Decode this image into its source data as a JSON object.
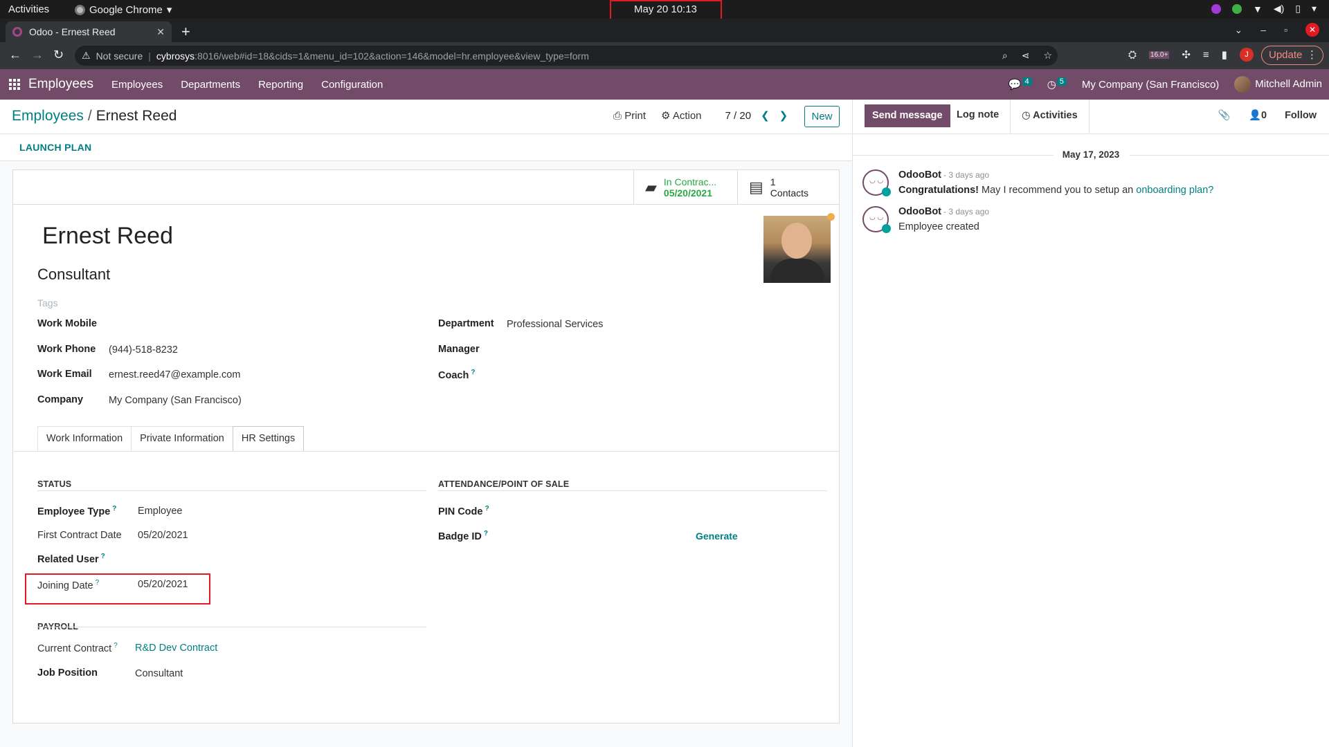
{
  "os_bar": {
    "activities": "Activities",
    "app_name": "Google Chrome",
    "clock": "May 20  10:13"
  },
  "browser": {
    "tab_title": "Odoo - Ernest Reed",
    "not_secure": "Not secure",
    "url_host": "cybrosys",
    "url_path": ":8016/web#id=18&cids=1&menu_id=102&action=146&model=hr.employee&view_type=form",
    "ext_badge": "16.0+",
    "profile_initial": "J",
    "update_label": "Update"
  },
  "navbar": {
    "app_title": "Employees",
    "menus": [
      "Employees",
      "Departments",
      "Reporting",
      "Configuration"
    ],
    "messages_count": "4",
    "activities_count": "5",
    "company": "My Company (San Francisco)",
    "user": "Mitchell Admin"
  },
  "control_panel": {
    "breadcrumb_parent": "Employees",
    "breadcrumb_current": "Ernest Reed",
    "print_label": "Print",
    "action_label": "Action",
    "pager": "7 / 20",
    "new_label": "New",
    "launch_plan_label": "LAUNCH PLAN"
  },
  "smart_buttons": {
    "contract_line1": "In Contrac...",
    "contract_line2": "05/20/2021",
    "contacts_count": "1",
    "contacts_label": "Contacts"
  },
  "employee": {
    "name": "Ernest Reed",
    "job_title": "Consultant",
    "tags_placeholder": "Tags",
    "work_mobile_label": "Work Mobile",
    "work_phone_label": "Work Phone",
    "work_phone": "(944)-518-8232",
    "work_email_label": "Work Email",
    "work_email": "ernest.reed47@example.com",
    "company_label": "Company",
    "company": "My Company (San Francisco)",
    "department_label": "Department",
    "department": "Professional Services",
    "manager_label": "Manager",
    "coach_label": "Coach"
  },
  "tabs": [
    "Work Information",
    "Private Information",
    "HR Settings"
  ],
  "hr_settings": {
    "status_title": "STATUS",
    "employee_type_label": "Employee Type",
    "employee_type": "Employee",
    "first_contract_label": "First Contract Date",
    "first_contract": "05/20/2021",
    "related_user_label": "Related User",
    "joining_date_label": "Joining Date",
    "joining_date": "05/20/2021",
    "attendance_title": "ATTENDANCE/POINT OF SALE",
    "pin_label": "PIN Code",
    "badge_label": "Badge ID",
    "generate_label": "Generate",
    "payroll_title": "PAYROLL",
    "current_contract_label": "Current Contract",
    "current_contract": "R&D Dev Contract",
    "job_position_label": "Job Position",
    "job_position": "Consultant"
  },
  "chatter": {
    "send_message": "Send message",
    "log_note": "Log note",
    "activities": "Activities",
    "followers_count": "0",
    "follow": "Follow",
    "date_separator": "May 17, 2023",
    "messages": [
      {
        "author": "OdooBot",
        "when": "- 3 days ago",
        "bold": "Congratulations!",
        "text": " May I recommend you to setup an ",
        "link": "onboarding plan?"
      },
      {
        "author": "OdooBot",
        "when": "- 3 days ago",
        "text": "Employee created"
      }
    ]
  }
}
